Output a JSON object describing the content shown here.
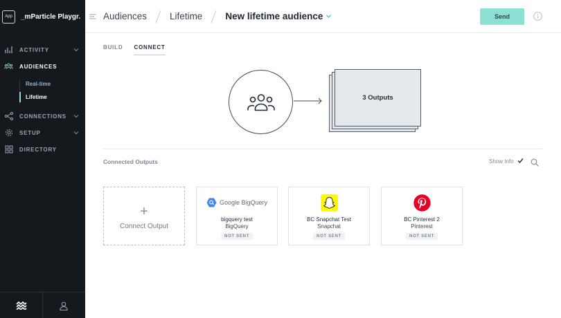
{
  "sidebar": {
    "app_badge": "App",
    "workspace_name": "_mParticle Playgr...",
    "items": [
      {
        "label": "ACTIVITY"
      },
      {
        "label": "AUDIENCES"
      },
      {
        "label": "CONNECTIONS"
      },
      {
        "label": "SETUP"
      },
      {
        "label": "DIRECTORY"
      }
    ],
    "audience_sub": [
      {
        "label": "Real-time"
      },
      {
        "label": "Lifetime"
      }
    ]
  },
  "header": {
    "crumb1": "Audiences",
    "crumb2": "Lifetime",
    "current": "New lifetime audience",
    "send_label": "Send"
  },
  "tabs": [
    {
      "label": "BUILD"
    },
    {
      "label": "CONNECT"
    }
  ],
  "diagram": {
    "outputs_label": "3 Outputs"
  },
  "connected": {
    "title": "Connected Outputs",
    "show_info": "Show Info",
    "connect_label": "Connect Output",
    "outputs": [
      {
        "logo_text": "Google BigQuery",
        "name": "bigquery test",
        "type": "BigQuery",
        "status": "NOT SENT"
      },
      {
        "name": "BC Snapchat Test",
        "type": "Snapchat",
        "status": "NOT SENT"
      },
      {
        "name": "BC Pinterest 2",
        "type": "Pinterest",
        "status": "NOT SENT"
      }
    ]
  },
  "colors": {
    "accent": "#8ce0d4",
    "sidebar_bg": "#15191e",
    "snapchat": "#fffc00",
    "pinterest": "#e60023",
    "bigquery": "#4285f4"
  }
}
